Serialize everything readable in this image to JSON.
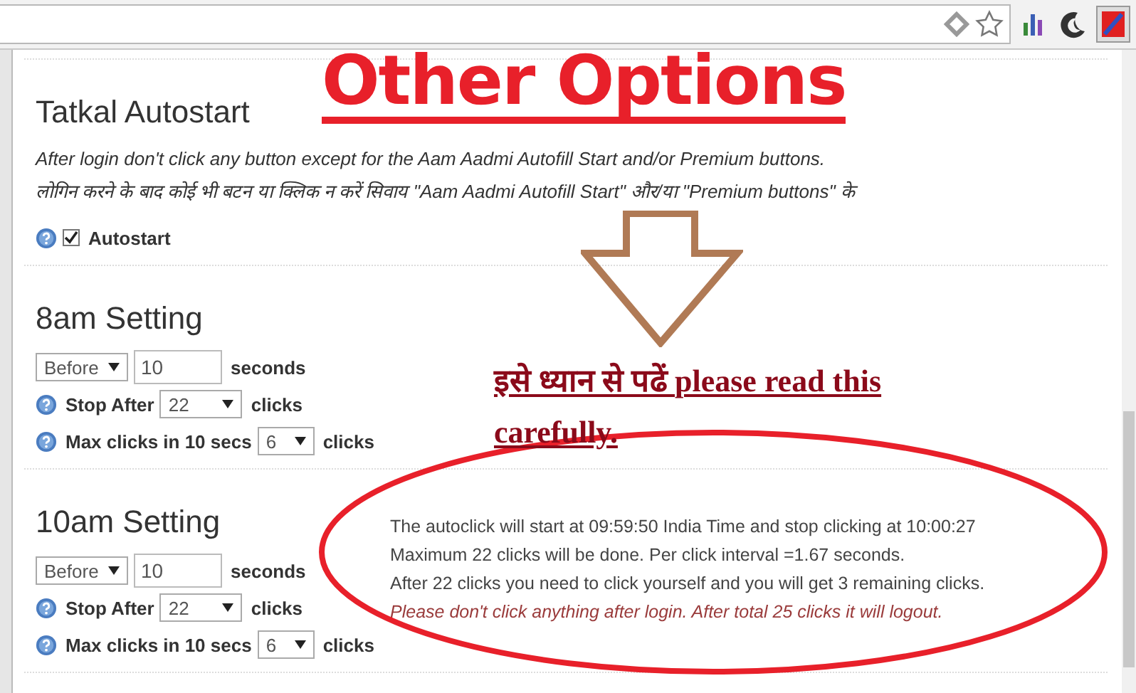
{
  "annotation": {
    "title": "Other Options",
    "note_hindi": "इसे ध्यान से पढें",
    "note": "please read this carefully."
  },
  "tatkal": {
    "heading": "Tatkal Autostart",
    "lines": [
      "After login don't click any button except for the Aam Aadmi Autofill Start and/or Premium buttons.",
      "लोगिन करने के बाद कोई भी बटन या क्लिक न करें सिवाय \"Aam Aadmi Autofill Start\" और/या \"Premium buttons\" के"
    ],
    "autostart": {
      "label": "Autostart",
      "checked": true
    }
  },
  "settings": [
    {
      "heading": "8am Setting",
      "mode": "Before",
      "seconds": "10",
      "seconds_label": "seconds",
      "stop_label": "Stop After",
      "stop_value": "22",
      "stop_unit": "clicks",
      "max_label": "Max clicks in 10 secs",
      "max_value": "6",
      "max_unit": "clicks"
    },
    {
      "heading": "10am Setting",
      "mode": "Before",
      "seconds": "10",
      "seconds_label": "seconds",
      "stop_label": "Stop After",
      "stop_value": "22",
      "stop_unit": "clicks",
      "max_label": "Max clicks in 10 secs",
      "max_value": "6",
      "max_unit": "clicks",
      "info": [
        {
          "kind": "normal",
          "text": "The autoclick will start at 09:59:50 India Time and stop clicking at 10:00:27"
        },
        {
          "kind": "normal",
          "text": "Maximum 22 clicks will be done. Per click interval =1.67 seconds."
        },
        {
          "kind": "normal",
          "text": "After 22 clicks you need to click yourself and you will get 3 remaining clicks."
        },
        {
          "kind": "warning",
          "text": "Please don't click anything after login. After total 25 clicks it will logout."
        }
      ]
    }
  ]
}
